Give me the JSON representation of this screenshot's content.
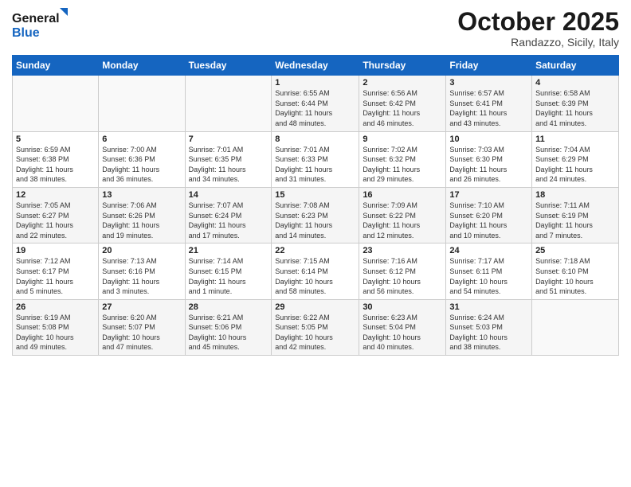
{
  "header": {
    "logo_general": "General",
    "logo_blue": "Blue",
    "month": "October 2025",
    "location": "Randazzo, Sicily, Italy"
  },
  "days_of_week": [
    "Sunday",
    "Monday",
    "Tuesday",
    "Wednesday",
    "Thursday",
    "Friday",
    "Saturday"
  ],
  "weeks": [
    [
      {
        "day": "",
        "info": ""
      },
      {
        "day": "",
        "info": ""
      },
      {
        "day": "",
        "info": ""
      },
      {
        "day": "1",
        "info": "Sunrise: 6:55 AM\nSunset: 6:44 PM\nDaylight: 11 hours\nand 48 minutes."
      },
      {
        "day": "2",
        "info": "Sunrise: 6:56 AM\nSunset: 6:42 PM\nDaylight: 11 hours\nand 46 minutes."
      },
      {
        "day": "3",
        "info": "Sunrise: 6:57 AM\nSunset: 6:41 PM\nDaylight: 11 hours\nand 43 minutes."
      },
      {
        "day": "4",
        "info": "Sunrise: 6:58 AM\nSunset: 6:39 PM\nDaylight: 11 hours\nand 41 minutes."
      }
    ],
    [
      {
        "day": "5",
        "info": "Sunrise: 6:59 AM\nSunset: 6:38 PM\nDaylight: 11 hours\nand 38 minutes."
      },
      {
        "day": "6",
        "info": "Sunrise: 7:00 AM\nSunset: 6:36 PM\nDaylight: 11 hours\nand 36 minutes."
      },
      {
        "day": "7",
        "info": "Sunrise: 7:01 AM\nSunset: 6:35 PM\nDaylight: 11 hours\nand 34 minutes."
      },
      {
        "day": "8",
        "info": "Sunrise: 7:01 AM\nSunset: 6:33 PM\nDaylight: 11 hours\nand 31 minutes."
      },
      {
        "day": "9",
        "info": "Sunrise: 7:02 AM\nSunset: 6:32 PM\nDaylight: 11 hours\nand 29 minutes."
      },
      {
        "day": "10",
        "info": "Sunrise: 7:03 AM\nSunset: 6:30 PM\nDaylight: 11 hours\nand 26 minutes."
      },
      {
        "day": "11",
        "info": "Sunrise: 7:04 AM\nSunset: 6:29 PM\nDaylight: 11 hours\nand 24 minutes."
      }
    ],
    [
      {
        "day": "12",
        "info": "Sunrise: 7:05 AM\nSunset: 6:27 PM\nDaylight: 11 hours\nand 22 minutes."
      },
      {
        "day": "13",
        "info": "Sunrise: 7:06 AM\nSunset: 6:26 PM\nDaylight: 11 hours\nand 19 minutes."
      },
      {
        "day": "14",
        "info": "Sunrise: 7:07 AM\nSunset: 6:24 PM\nDaylight: 11 hours\nand 17 minutes."
      },
      {
        "day": "15",
        "info": "Sunrise: 7:08 AM\nSunset: 6:23 PM\nDaylight: 11 hours\nand 14 minutes."
      },
      {
        "day": "16",
        "info": "Sunrise: 7:09 AM\nSunset: 6:22 PM\nDaylight: 11 hours\nand 12 minutes."
      },
      {
        "day": "17",
        "info": "Sunrise: 7:10 AM\nSunset: 6:20 PM\nDaylight: 11 hours\nand 10 minutes."
      },
      {
        "day": "18",
        "info": "Sunrise: 7:11 AM\nSunset: 6:19 PM\nDaylight: 11 hours\nand 7 minutes."
      }
    ],
    [
      {
        "day": "19",
        "info": "Sunrise: 7:12 AM\nSunset: 6:17 PM\nDaylight: 11 hours\nand 5 minutes."
      },
      {
        "day": "20",
        "info": "Sunrise: 7:13 AM\nSunset: 6:16 PM\nDaylight: 11 hours\nand 3 minutes."
      },
      {
        "day": "21",
        "info": "Sunrise: 7:14 AM\nSunset: 6:15 PM\nDaylight: 11 hours\nand 1 minute."
      },
      {
        "day": "22",
        "info": "Sunrise: 7:15 AM\nSunset: 6:14 PM\nDaylight: 10 hours\nand 58 minutes."
      },
      {
        "day": "23",
        "info": "Sunrise: 7:16 AM\nSunset: 6:12 PM\nDaylight: 10 hours\nand 56 minutes."
      },
      {
        "day": "24",
        "info": "Sunrise: 7:17 AM\nSunset: 6:11 PM\nDaylight: 10 hours\nand 54 minutes."
      },
      {
        "day": "25",
        "info": "Sunrise: 7:18 AM\nSunset: 6:10 PM\nDaylight: 10 hours\nand 51 minutes."
      }
    ],
    [
      {
        "day": "26",
        "info": "Sunrise: 6:19 AM\nSunset: 5:08 PM\nDaylight: 10 hours\nand 49 minutes."
      },
      {
        "day": "27",
        "info": "Sunrise: 6:20 AM\nSunset: 5:07 PM\nDaylight: 10 hours\nand 47 minutes."
      },
      {
        "day": "28",
        "info": "Sunrise: 6:21 AM\nSunset: 5:06 PM\nDaylight: 10 hours\nand 45 minutes."
      },
      {
        "day": "29",
        "info": "Sunrise: 6:22 AM\nSunset: 5:05 PM\nDaylight: 10 hours\nand 42 minutes."
      },
      {
        "day": "30",
        "info": "Sunrise: 6:23 AM\nSunset: 5:04 PM\nDaylight: 10 hours\nand 40 minutes."
      },
      {
        "day": "31",
        "info": "Sunrise: 6:24 AM\nSunset: 5:03 PM\nDaylight: 10 hours\nand 38 minutes."
      },
      {
        "day": "",
        "info": ""
      }
    ]
  ]
}
